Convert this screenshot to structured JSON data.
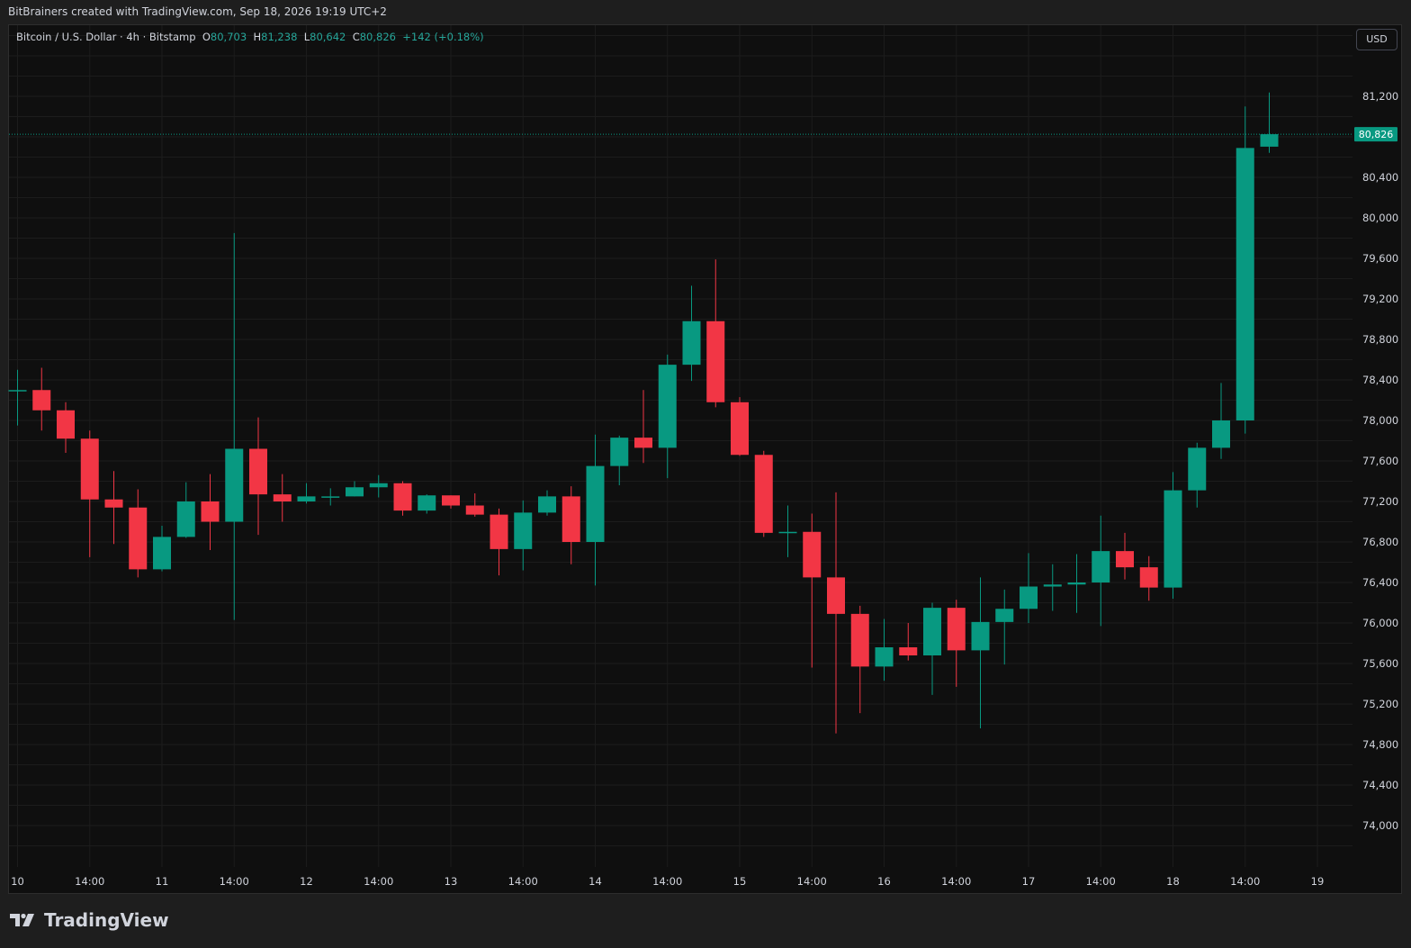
{
  "credit": "BitBrainers created with TradingView.com, Sep 18, 2026 19:19 UTC+2",
  "legend": {
    "symbol": "Bitcoin / U.S. Dollar · 4h · Bitstamp",
    "o_label": "O",
    "o_value": "80,703",
    "h_label": "H",
    "h_value": "81,238",
    "l_label": "L",
    "l_value": "80,642",
    "c_label": "C",
    "c_value": "80,826",
    "change": "+142 (+0.18%)"
  },
  "currency_button": "USD",
  "brand": "TradingView",
  "colors": {
    "up": "#089981",
    "down": "#f23645",
    "background": "#0f0f0f",
    "grid": "#1c1c1c",
    "text": "#d1d4dc"
  },
  "chart_data": {
    "type": "candlestick",
    "interval": "4h",
    "ylim": [
      73600,
      81900
    ],
    "y_ticks": [
      74000,
      74400,
      74800,
      75200,
      75600,
      76000,
      76400,
      76800,
      77200,
      77600,
      78000,
      78400,
      78800,
      79200,
      79600,
      80000,
      80400,
      81200
    ],
    "y_tick_labels": [
      "74,000",
      "74,400",
      "74,800",
      "75,200",
      "75,600",
      "76,000",
      "76,400",
      "76,800",
      "77,200",
      "77,600",
      "78,000",
      "78,400",
      "78,800",
      "79,200",
      "79,600",
      "80,000",
      "80,400",
      "81,200"
    ],
    "x_tick_labels": [
      "10",
      "14:00",
      "11",
      "14:00",
      "12",
      "14:00",
      "13",
      "14:00",
      "14",
      "14:00",
      "15",
      "14:00",
      "16",
      "14:00",
      "17",
      "14:00",
      "18",
      "14:00",
      "19"
    ],
    "x_tick_positions": [
      0,
      3,
      6,
      9,
      12,
      15,
      18,
      21,
      24,
      27,
      30,
      33,
      36,
      39,
      42,
      45,
      48,
      51,
      54
    ],
    "last_price": 80826,
    "last_price_label": "80,826",
    "candles": [
      {
        "o": 78300,
        "h": 78500,
        "l": 77950,
        "c": 78300
      },
      {
        "o": 78300,
        "h": 78520,
        "l": 77900,
        "c": 78100
      },
      {
        "o": 78100,
        "h": 78180,
        "l": 77680,
        "c": 77820
      },
      {
        "o": 77820,
        "h": 77900,
        "l": 76650,
        "c": 77220
      },
      {
        "o": 77220,
        "h": 77500,
        "l": 76780,
        "c": 77140
      },
      {
        "o": 77140,
        "h": 77320,
        "l": 76450,
        "c": 76530
      },
      {
        "o": 76530,
        "h": 76960,
        "l": 76510,
        "c": 76850
      },
      {
        "o": 76850,
        "h": 77390,
        "l": 76840,
        "c": 77200
      },
      {
        "o": 77200,
        "h": 77470,
        "l": 76720,
        "c": 77000
      },
      {
        "o": 77000,
        "h": 79850,
        "l": 76030,
        "c": 77720
      },
      {
        "o": 77720,
        "h": 78030,
        "l": 76870,
        "c": 77270
      },
      {
        "o": 77270,
        "h": 77470,
        "l": 77000,
        "c": 77200
      },
      {
        "o": 77200,
        "h": 77380,
        "l": 77180,
        "c": 77250
      },
      {
        "o": 77250,
        "h": 77330,
        "l": 77160,
        "c": 77250
      },
      {
        "o": 77250,
        "h": 77400,
        "l": 77250,
        "c": 77340
      },
      {
        "o": 77340,
        "h": 77460,
        "l": 77240,
        "c": 77380
      },
      {
        "o": 77380,
        "h": 77400,
        "l": 77060,
        "c": 77110
      },
      {
        "o": 77110,
        "h": 77270,
        "l": 77080,
        "c": 77260
      },
      {
        "o": 77260,
        "h": 77260,
        "l": 77130,
        "c": 77160
      },
      {
        "o": 77160,
        "h": 77280,
        "l": 77050,
        "c": 77070
      },
      {
        "o": 77070,
        "h": 77130,
        "l": 76470,
        "c": 76730
      },
      {
        "o": 76730,
        "h": 77210,
        "l": 76520,
        "c": 77090
      },
      {
        "o": 77090,
        "h": 77310,
        "l": 77060,
        "c": 77250
      },
      {
        "o": 77250,
        "h": 77350,
        "l": 76580,
        "c": 76800
      },
      {
        "o": 76800,
        "h": 77860,
        "l": 76370,
        "c": 77550
      },
      {
        "o": 77550,
        "h": 77850,
        "l": 77360,
        "c": 77830
      },
      {
        "o": 77830,
        "h": 78300,
        "l": 77580,
        "c": 77730
      },
      {
        "o": 77730,
        "h": 78650,
        "l": 77430,
        "c": 78550
      },
      {
        "o": 78550,
        "h": 79330,
        "l": 78390,
        "c": 78980
      },
      {
        "o": 78980,
        "h": 79590,
        "l": 78130,
        "c": 78180
      },
      {
        "o": 78180,
        "h": 78230,
        "l": 77650,
        "c": 77660
      },
      {
        "o": 77660,
        "h": 77700,
        "l": 76850,
        "c": 76890
      },
      {
        "o": 76890,
        "h": 77160,
        "l": 76650,
        "c": 76900
      },
      {
        "o": 76900,
        "h": 77080,
        "l": 75560,
        "c": 76450
      },
      {
        "o": 76450,
        "h": 77290,
        "l": 74910,
        "c": 76090
      },
      {
        "o": 76090,
        "h": 76170,
        "l": 75110,
        "c": 75570
      },
      {
        "o": 75570,
        "h": 76040,
        "l": 75430,
        "c": 75760
      },
      {
        "o": 75760,
        "h": 76000,
        "l": 75630,
        "c": 75680
      },
      {
        "o": 75680,
        "h": 76200,
        "l": 75290,
        "c": 76150
      },
      {
        "o": 76150,
        "h": 76230,
        "l": 75370,
        "c": 75730
      },
      {
        "o": 75730,
        "h": 76450,
        "l": 74960,
        "c": 76010
      },
      {
        "o": 76010,
        "h": 76330,
        "l": 75590,
        "c": 76140
      },
      {
        "o": 76140,
        "h": 76690,
        "l": 76000,
        "c": 76360
      },
      {
        "o": 76360,
        "h": 76580,
        "l": 76120,
        "c": 76380
      },
      {
        "o": 76380,
        "h": 76680,
        "l": 76100,
        "c": 76400
      },
      {
        "o": 76400,
        "h": 77060,
        "l": 75970,
        "c": 76710
      },
      {
        "o": 76710,
        "h": 76890,
        "l": 76430,
        "c": 76550
      },
      {
        "o": 76550,
        "h": 76660,
        "l": 76220,
        "c": 76350
      },
      {
        "o": 76350,
        "h": 77490,
        "l": 76240,
        "c": 77310
      },
      {
        "o": 77310,
        "h": 77780,
        "l": 77140,
        "c": 77730
      },
      {
        "o": 77730,
        "h": 78370,
        "l": 77620,
        "c": 78000
      },
      {
        "o": 78000,
        "h": 81100,
        "l": 77870,
        "c": 80690
      },
      {
        "o": 80703,
        "h": 81238,
        "l": 80642,
        "c": 80826
      }
    ]
  }
}
